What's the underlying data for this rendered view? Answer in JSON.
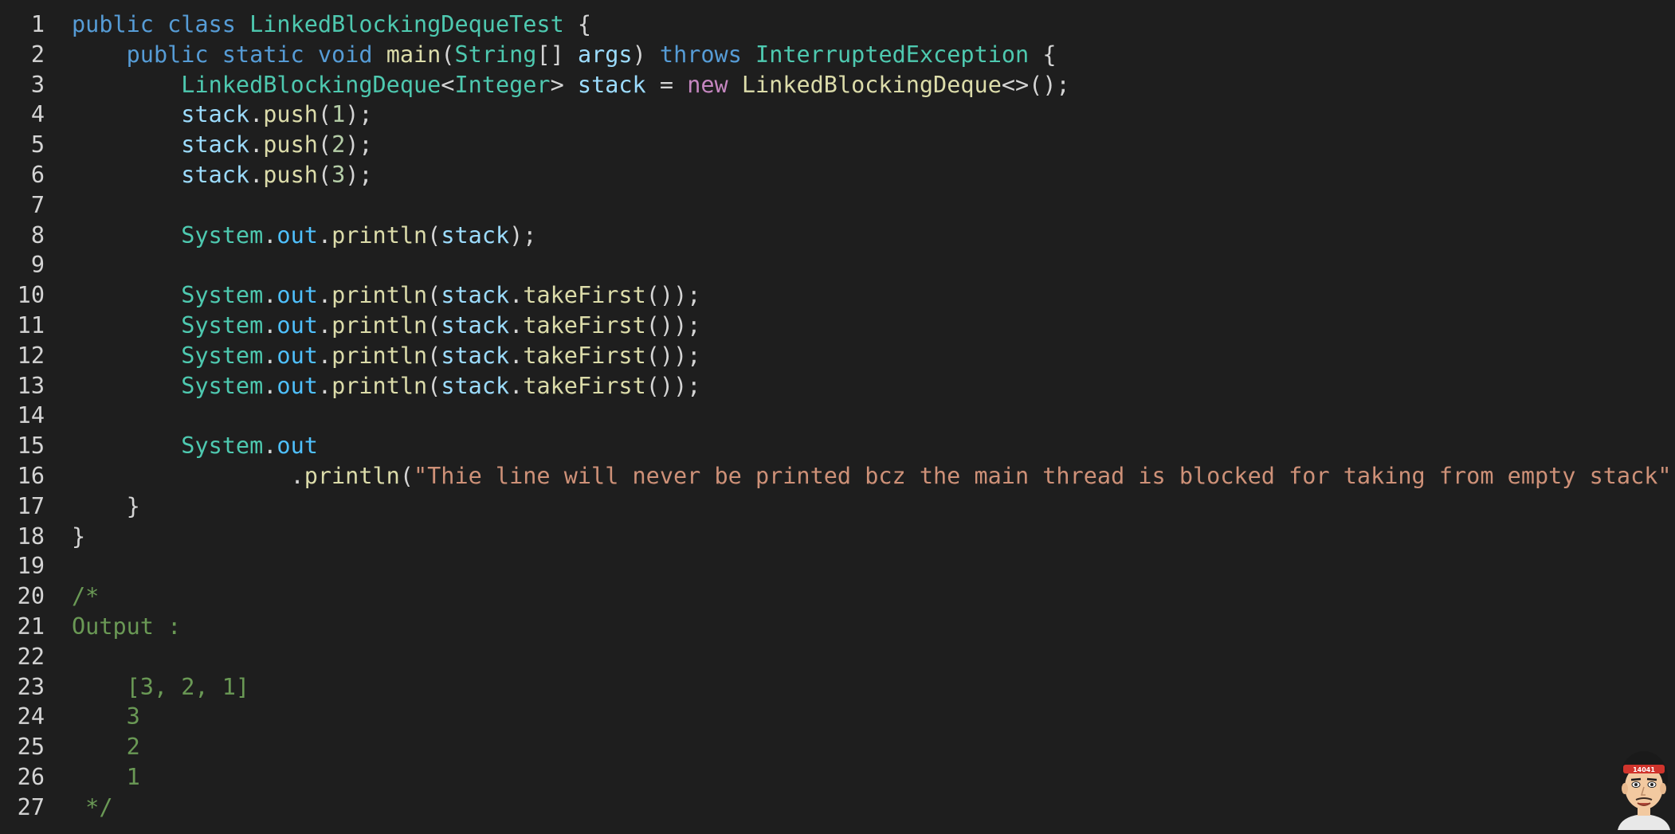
{
  "editor": {
    "lines": [
      {
        "n": "1",
        "tokens": [
          [
            "kw",
            "public"
          ],
          [
            "plain",
            " "
          ],
          [
            "kw",
            "class"
          ],
          [
            "plain",
            " "
          ],
          [
            "type",
            "LinkedBlockingDequeTest"
          ],
          [
            "plain",
            " {"
          ]
        ]
      },
      {
        "n": "2",
        "tokens": [
          [
            "plain",
            "    "
          ],
          [
            "kw",
            "public"
          ],
          [
            "plain",
            " "
          ],
          [
            "kw",
            "static"
          ],
          [
            "plain",
            " "
          ],
          [
            "kw",
            "void"
          ],
          [
            "plain",
            " "
          ],
          [
            "fn",
            "main"
          ],
          [
            "plain",
            "("
          ],
          [
            "type",
            "String"
          ],
          [
            "plain",
            "[] "
          ],
          [
            "var",
            "args"
          ],
          [
            "plain",
            ") "
          ],
          [
            "kw",
            "throws"
          ],
          [
            "plain",
            " "
          ],
          [
            "type",
            "InterruptedException"
          ],
          [
            "plain",
            " {"
          ]
        ]
      },
      {
        "n": "3",
        "tokens": [
          [
            "plain",
            "        "
          ],
          [
            "type",
            "LinkedBlockingDeque"
          ],
          [
            "plain",
            "<"
          ],
          [
            "type",
            "Integer"
          ],
          [
            "plain",
            "> "
          ],
          [
            "var",
            "stack"
          ],
          [
            "plain",
            " = "
          ],
          [
            "kw2",
            "new"
          ],
          [
            "plain",
            " "
          ],
          [
            "fn",
            "LinkedBlockingDeque"
          ],
          [
            "plain",
            "<>();"
          ]
        ]
      },
      {
        "n": "4",
        "tokens": [
          [
            "plain",
            "        "
          ],
          [
            "var",
            "stack"
          ],
          [
            "plain",
            "."
          ],
          [
            "fn",
            "push"
          ],
          [
            "plain",
            "("
          ],
          [
            "num",
            "1"
          ],
          [
            "plain",
            ");"
          ]
        ]
      },
      {
        "n": "5",
        "tokens": [
          [
            "plain",
            "        "
          ],
          [
            "var",
            "stack"
          ],
          [
            "plain",
            "."
          ],
          [
            "fn",
            "push"
          ],
          [
            "plain",
            "("
          ],
          [
            "num",
            "2"
          ],
          [
            "plain",
            ");"
          ]
        ]
      },
      {
        "n": "6",
        "tokens": [
          [
            "plain",
            "        "
          ],
          [
            "var",
            "stack"
          ],
          [
            "plain",
            "."
          ],
          [
            "fn",
            "push"
          ],
          [
            "plain",
            "("
          ],
          [
            "num",
            "3"
          ],
          [
            "plain",
            ");"
          ]
        ]
      },
      {
        "n": "7",
        "tokens": []
      },
      {
        "n": "8",
        "tokens": [
          [
            "plain",
            "        "
          ],
          [
            "type",
            "System"
          ],
          [
            "plain",
            "."
          ],
          [
            "field",
            "out"
          ],
          [
            "plain",
            "."
          ],
          [
            "fn",
            "println"
          ],
          [
            "plain",
            "("
          ],
          [
            "var",
            "stack"
          ],
          [
            "plain",
            ");"
          ]
        ]
      },
      {
        "n": "9",
        "tokens": []
      },
      {
        "n": "10",
        "tokens": [
          [
            "plain",
            "        "
          ],
          [
            "type",
            "System"
          ],
          [
            "plain",
            "."
          ],
          [
            "field",
            "out"
          ],
          [
            "plain",
            "."
          ],
          [
            "fn",
            "println"
          ],
          [
            "plain",
            "("
          ],
          [
            "var",
            "stack"
          ],
          [
            "plain",
            "."
          ],
          [
            "fn",
            "takeFirst"
          ],
          [
            "plain",
            "());"
          ]
        ]
      },
      {
        "n": "11",
        "tokens": [
          [
            "plain",
            "        "
          ],
          [
            "type",
            "System"
          ],
          [
            "plain",
            "."
          ],
          [
            "field",
            "out"
          ],
          [
            "plain",
            "."
          ],
          [
            "fn",
            "println"
          ],
          [
            "plain",
            "("
          ],
          [
            "var",
            "stack"
          ],
          [
            "plain",
            "."
          ],
          [
            "fn",
            "takeFirst"
          ],
          [
            "plain",
            "());"
          ]
        ]
      },
      {
        "n": "12",
        "tokens": [
          [
            "plain",
            "        "
          ],
          [
            "type",
            "System"
          ],
          [
            "plain",
            "."
          ],
          [
            "field",
            "out"
          ],
          [
            "plain",
            "."
          ],
          [
            "fn",
            "println"
          ],
          [
            "plain",
            "("
          ],
          [
            "var",
            "stack"
          ],
          [
            "plain",
            "."
          ],
          [
            "fn",
            "takeFirst"
          ],
          [
            "plain",
            "());"
          ]
        ]
      },
      {
        "n": "13",
        "tokens": [
          [
            "plain",
            "        "
          ],
          [
            "type",
            "System"
          ],
          [
            "plain",
            "."
          ],
          [
            "field",
            "out"
          ],
          [
            "plain",
            "."
          ],
          [
            "fn",
            "println"
          ],
          [
            "plain",
            "("
          ],
          [
            "var",
            "stack"
          ],
          [
            "plain",
            "."
          ],
          [
            "fn",
            "takeFirst"
          ],
          [
            "plain",
            "());"
          ]
        ]
      },
      {
        "n": "14",
        "tokens": []
      },
      {
        "n": "15",
        "tokens": [
          [
            "plain",
            "        "
          ],
          [
            "type",
            "System"
          ],
          [
            "plain",
            "."
          ],
          [
            "field",
            "out"
          ]
        ]
      },
      {
        "n": "16",
        "tokens": [
          [
            "plain",
            "                ."
          ],
          [
            "fn",
            "println"
          ],
          [
            "plain",
            "("
          ],
          [
            "str",
            "\"Thie line will never be printed bcz the main thread is blocked for taking from empty stack\""
          ],
          [
            "plain",
            ");"
          ]
        ]
      },
      {
        "n": "17",
        "tokens": [
          [
            "plain",
            "    }"
          ]
        ]
      },
      {
        "n": "18",
        "tokens": [
          [
            "plain",
            "}"
          ]
        ]
      },
      {
        "n": "19",
        "tokens": []
      },
      {
        "n": "20",
        "tokens": [
          [
            "cm",
            "/*"
          ]
        ]
      },
      {
        "n": "21",
        "tokens": [
          [
            "cm",
            "Output :"
          ]
        ]
      },
      {
        "n": "22",
        "tokens": []
      },
      {
        "n": "23",
        "tokens": [
          [
            "cm",
            "    [3, 2, 1]"
          ]
        ]
      },
      {
        "n": "24",
        "tokens": [
          [
            "cm",
            "    3"
          ]
        ]
      },
      {
        "n": "25",
        "tokens": [
          [
            "cm",
            "    2"
          ]
        ]
      },
      {
        "n": "26",
        "tokens": [
          [
            "cm",
            "    1"
          ]
        ]
      },
      {
        "n": "27",
        "tokens": [
          [
            "cm",
            " */"
          ]
        ]
      }
    ]
  },
  "avatar": {
    "icon": "cartoon-avatar-icon",
    "badge_text": "14041",
    "colors": {
      "skin": "#f2c9a0",
      "hair": "#1a1a1a",
      "band": "#d0342c"
    }
  }
}
